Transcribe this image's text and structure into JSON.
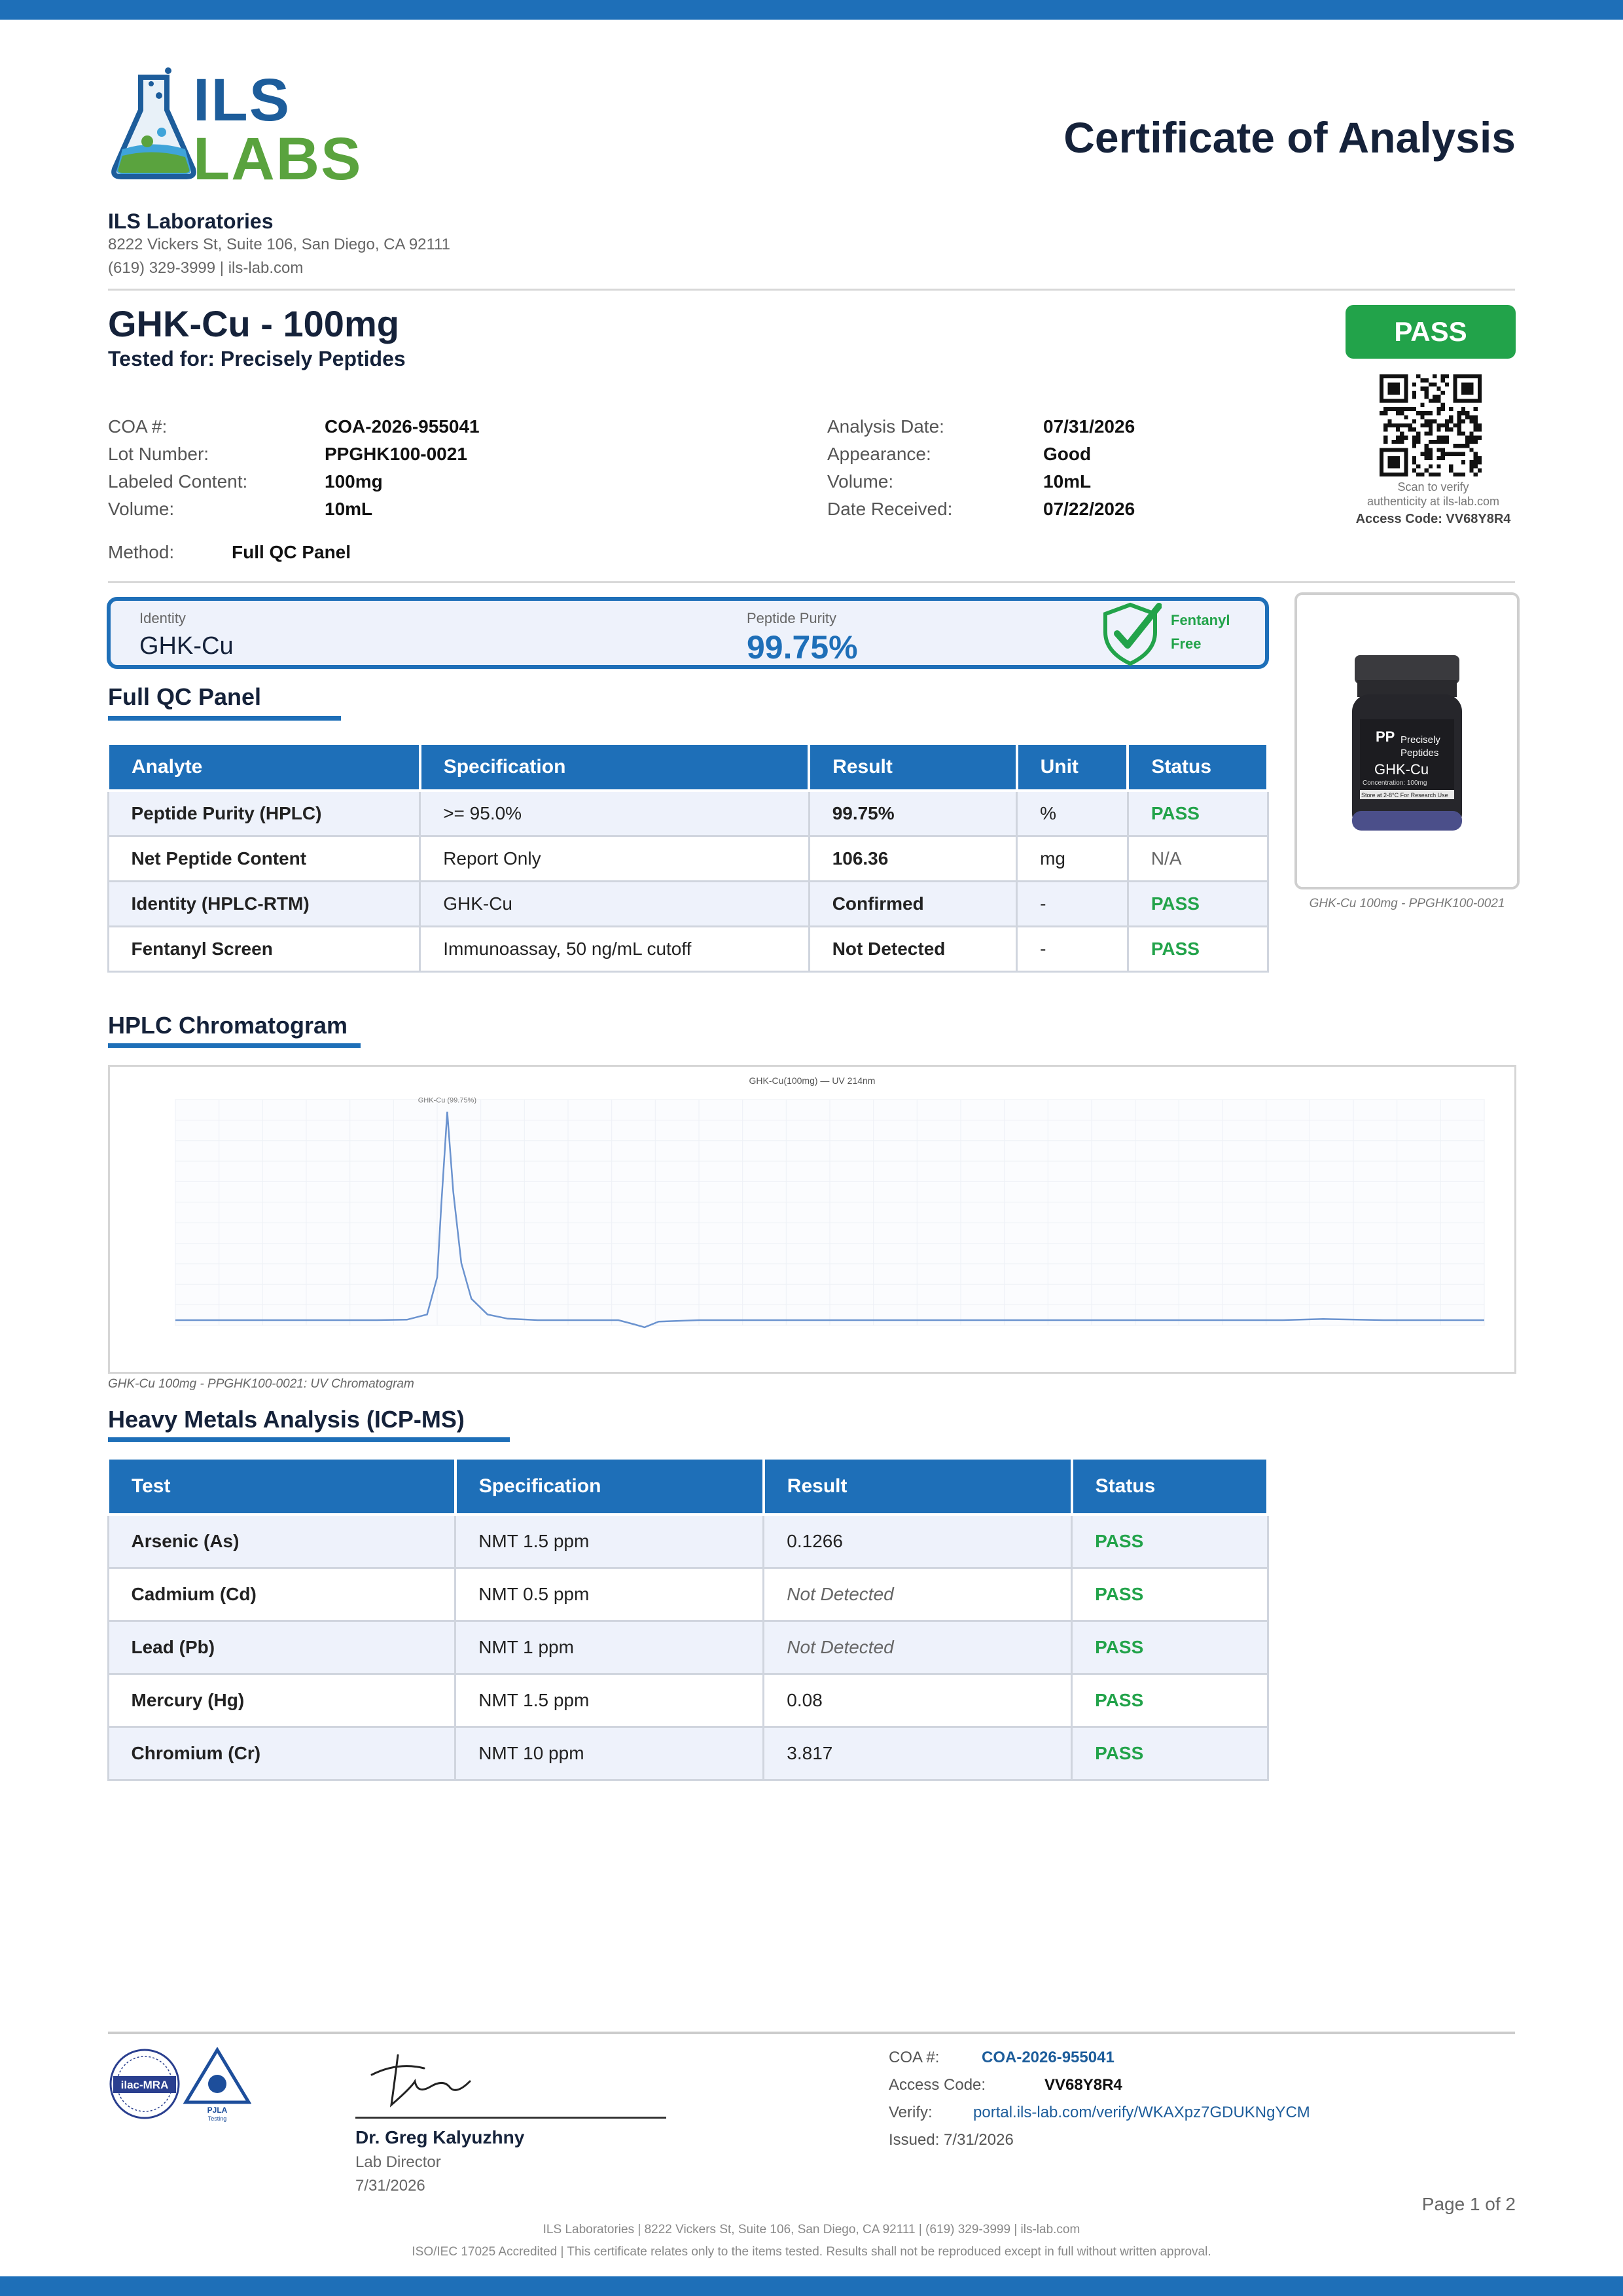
{
  "header": {
    "logo_line1": "ILS",
    "logo_line2": "LABS",
    "certificate_title": "Certificate of Analysis",
    "lab_name": "ILS Laboratories",
    "address": "8222 Vickers St, Suite 106, San Diego, CA 92111",
    "contact": "(619) 329-3999  |  ils-lab.com"
  },
  "product": {
    "title": "GHK-Cu - 100mg",
    "tested_for": "Tested for: Precisely Peptides",
    "pass_badge": "PASS",
    "qr_caption1": "Scan to verify",
    "qr_caption2": "authenticity at ils-lab.com",
    "access_code_line": "Access Code: VV68Y8R4"
  },
  "details_left": [
    {
      "label": "COA #:",
      "value": "COA-2026-955041"
    },
    {
      "label": "Lot Number:",
      "value": "PPGHK100-0021"
    },
    {
      "label": "Labeled Content:",
      "value": "100mg"
    },
    {
      "label": "Volume:",
      "value": "10mL"
    }
  ],
  "details_right": [
    {
      "label": "Analysis Date:",
      "value": "07/31/2026"
    },
    {
      "label": "Appearance:",
      "value": "Good"
    },
    {
      "label": "Volume:",
      "value": "10mL"
    },
    {
      "label": "Date Received:",
      "value": "07/22/2026"
    }
  ],
  "method": {
    "label": "Method:",
    "value": "Full QC Panel"
  },
  "identity_box": {
    "identity_label": "Identity",
    "identity_value": "GHK-Cu",
    "purity_label": "Peptide Purity",
    "purity_value": "99.75%",
    "fentanyl_line1": "Fentanyl",
    "fentanyl_line2": "Free"
  },
  "product_image": {
    "vial_brand1": "Precisely",
    "vial_brand2": "Peptides",
    "vial_name": "GHK-Cu",
    "vial_conc": "Concentration: 100mg",
    "vial_storage": "Store at 2-8°C For Research Use",
    "caption": "GHK-Cu 100mg - PPGHK100-0021"
  },
  "qc_panel": {
    "title": "Full QC Panel",
    "headers": [
      "Analyte",
      "Specification",
      "Result",
      "Unit",
      "Status"
    ],
    "rows": [
      [
        "Peptide Purity (HPLC)",
        ">= 95.0%",
        "99.75%",
        "%",
        "PASS"
      ],
      [
        "Net Peptide Content",
        "Report Only",
        "106.36",
        "mg",
        "N/A"
      ],
      [
        "Identity (HPLC-RTM)",
        "GHK-Cu",
        "Confirmed",
        "-",
        "PASS"
      ],
      [
        "Fentanyl Screen",
        "Immunoassay, 50 ng/mL cutoff",
        "Not Detected",
        "-",
        "PASS"
      ]
    ]
  },
  "chromatogram": {
    "title": "HPLC Chromatogram",
    "chart_title": "GHK-Cu(100mg) — UV 214nm",
    "caption": "GHK-Cu 100mg - PPGHK100-0021: UV Chromatogram"
  },
  "chart_data": {
    "type": "line",
    "title": "GHK-Cu(100mg) — UV 214nm",
    "peak_label": "GHK-Cu (99.75%)",
    "xlim": [
      0,
      6.5
    ],
    "ylim": [
      0,
      150
    ],
    "xlabel": "",
    "ylabel": "",
    "series": [
      {
        "name": "",
        "x": [
          0,
          0.4,
          0.8,
          1.0,
          1.15,
          1.25,
          1.3,
          1.32,
          1.35,
          1.38,
          1.42,
          1.47,
          1.55,
          1.65,
          1.8,
          2.0,
          2.2,
          2.28,
          2.33,
          2.4,
          2.6,
          3.0,
          4.0,
          5.0,
          5.5,
          5.7,
          6.0,
          6.5
        ],
        "y": [
          0,
          0,
          0,
          0,
          0.3,
          4,
          30,
          80,
          146,
          90,
          40,
          15,
          4,
          1,
          0,
          0,
          0,
          -3,
          -5,
          -1,
          0,
          0,
          0,
          0,
          0,
          0.8,
          0,
          0
        ]
      }
    ]
  },
  "metals": {
    "title": "Heavy Metals Analysis (ICP-MS)",
    "headers": [
      "Test",
      "Specification",
      "Result",
      "Status"
    ],
    "rows": [
      [
        "Arsenic (As)",
        "NMT 1.5 ppm",
        "0.1266",
        "PASS"
      ],
      [
        "Cadmium (Cd)",
        "NMT 0.5 ppm",
        "Not Detected",
        "PASS"
      ],
      [
        "Lead (Pb)",
        "NMT 1 ppm",
        "Not Detected",
        "PASS"
      ],
      [
        "Mercury (Hg)",
        "NMT 1.5 ppm",
        "0.08",
        "PASS"
      ],
      [
        "Chromium (Cr)",
        "NMT 10 ppm",
        "3.817",
        "PASS"
      ]
    ]
  },
  "footer": {
    "ilac_label": "ilac-MRA",
    "pjla_label": "PJLA",
    "pjla_sub": "Testing",
    "signer_name": "Dr. Greg Kalyuzhny",
    "signer_role": "Lab Director",
    "signer_date": "7/31/2026",
    "coa_label": "COA #:",
    "coa_value": "COA-2026-955041",
    "access_label": "Access Code:",
    "access_value": "VV68Y8R4",
    "verify_label": "Verify:",
    "verify_value": "portal.ils-lab.com/verify/WKAXpz7GDUKNgYCM",
    "issued": "Issued: 7/31/2026",
    "page": "Page 1 of 2",
    "line1": "ILS Laboratories  |  8222 Vickers St, Suite 106, San Diego, CA 92111  |  (619) 329-3999  |  ils-lab.com",
    "line2": "ISO/IEC 17025 Accredited  |  This certificate relates only to the items tested. Results shall not be reproduced except in full without written approval."
  },
  "colors": {
    "primary": "#1e6fb8",
    "pass": "#22a34a",
    "navy": "#15223a"
  }
}
